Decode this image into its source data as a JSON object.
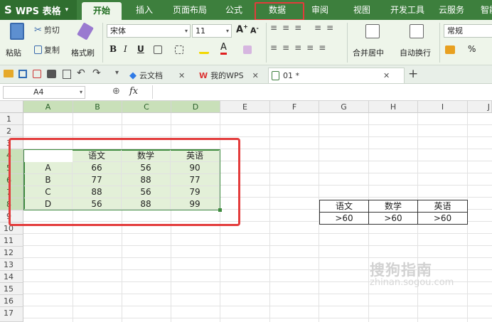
{
  "menubar": {
    "app_title": "WPS 表格",
    "tabs": [
      "开始",
      "插入",
      "页面布局",
      "公式",
      "数据",
      "审阅",
      "视图",
      "开发工具",
      "云服务",
      "智能"
    ]
  },
  "ribbon": {
    "paste": "粘贴",
    "cut": "剪切",
    "copy": "复制",
    "format_painter": "格式刷",
    "font_name": "宋体",
    "font_size": "11",
    "merge_center": "合并居中",
    "wrap_text": "自动换行",
    "number_format": "常规",
    "percent": "%"
  },
  "tabbar": {
    "tabs": [
      {
        "label": "云文档",
        "icon": "cloud-doc-icon"
      },
      {
        "label": "我的WPS",
        "icon": "wps-logo-icon"
      },
      {
        "label": "01 *",
        "icon": "sheet-icon"
      }
    ]
  },
  "formula_bar": {
    "cell_ref": "A4",
    "fx": "fx",
    "content": ""
  },
  "sheet": {
    "columns": [
      "A",
      "B",
      "C",
      "D",
      "E",
      "F",
      "G",
      "H",
      "I",
      "J"
    ],
    "rows": [
      "1",
      "2",
      "3",
      "4",
      "5",
      "6",
      "7",
      "8",
      "9",
      "10",
      "11",
      "12",
      "13",
      "14",
      "15",
      "16",
      "17"
    ],
    "main_table": {
      "header": [
        "",
        "语文",
        "数学",
        "英语"
      ],
      "rows": [
        [
          "A",
          "66",
          "56",
          "90"
        ],
        [
          "B",
          "77",
          "88",
          "77"
        ],
        [
          "C",
          "88",
          "56",
          "79"
        ],
        [
          "D",
          "56",
          "88",
          "99"
        ]
      ]
    },
    "criteria_table": {
      "header": [
        "语文",
        "数学",
        "英语"
      ],
      "values": [
        ">60",
        ">60",
        ">60"
      ]
    }
  },
  "colors": {
    "accent": "#3d7f3d",
    "highlight_box": "#e33b3b",
    "selection": "#e3f0d8"
  },
  "watermark": {
    "brand": "搜狗指南",
    "url": "zhinan.sogou.com"
  }
}
